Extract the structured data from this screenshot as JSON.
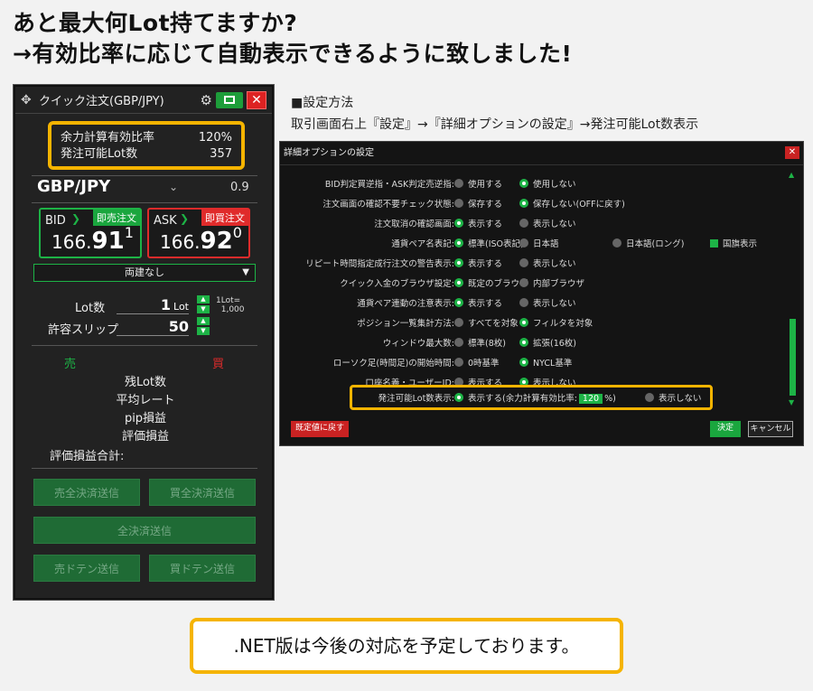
{
  "headline": {
    "line1": "あと最大何Lot持てますか?",
    "line2": "→有効比率に応じて自動表示できるように致しました!"
  },
  "quick_order": {
    "title": "クイック注文(GBP/JPY)",
    "margin_label": "余力計算有効比率",
    "margin_value": "120%",
    "orderable_label": "発注可能Lot数",
    "orderable_value": "357",
    "pair": "GBP/JPY",
    "spread": "0.9",
    "bid": {
      "label": "BID",
      "tag": "即売注文",
      "small": "166.",
      "big": "91",
      "sup": "1"
    },
    "ask": {
      "label": "ASK",
      "tag": "即買注文",
      "small": "166.",
      "big": "92",
      "sup": "0"
    },
    "hedge": "両建なし",
    "lot_label": "Lot数",
    "lot_value": "1",
    "lot_unit": "Lot",
    "lot_note_1": "1Lot=",
    "lot_note_2": "1,000",
    "slip_label": "許容スリップ",
    "slip_value": "50",
    "sell": "売",
    "buy": "買",
    "stats": [
      "残Lot数",
      "平均レート",
      "pip損益",
      "評価損益"
    ],
    "eval_total": "評価損益合計:",
    "buttons": {
      "sell_close": "売全決済送信",
      "buy_close": "買全決済送信",
      "all_close": "全決済送信",
      "sell_doten": "売ドテン送信",
      "buy_doten": "買ドテン送信"
    }
  },
  "settings": {
    "heading": "■設定方法",
    "path": "取引画面右上『設定』→『詳細オプションの設定』→発注可能Lot数表示"
  },
  "dialog": {
    "title": "詳細オプションの設定",
    "rows": [
      {
        "label": "BID判定買逆指・ASK判定売逆指:",
        "o1": "使用する",
        "o2": "使用しない",
        "sel": 2
      },
      {
        "label": "注文画面の確認不要チェック状態:",
        "o1": "保存する",
        "o2": "保存しない(OFFに戻す)",
        "sel": 2
      },
      {
        "label": "注文取消の確認画面:",
        "o1": "表示する",
        "o2": "表示しない",
        "sel": 1
      },
      {
        "label": "通貨ペア名表記:",
        "o1": "標準(ISO表記)",
        "o2": "日本語",
        "o3": "日本語(ロング)",
        "o4": "国旗表示",
        "sel": 1
      },
      {
        "label": "リピート時間指定成行注文の警告表示:",
        "o1": "表示する",
        "o2": "表示しない",
        "sel": 1
      },
      {
        "label": "クイック入金のブラウザ設定:",
        "o1": "既定のブラウザ",
        "o2": "内部ブラウザ",
        "sel": 1
      },
      {
        "label": "通貨ペア連動の注意表示:",
        "o1": "表示する",
        "o2": "表示しない",
        "sel": 1
      },
      {
        "label": "ポジション一覧集計方法:",
        "o1": "すべてを対象",
        "o2": "フィルタを対象",
        "sel": 2
      },
      {
        "label": "ウィンドウ最大数:",
        "o1": "標準(8枚)",
        "o2": "拡張(16枚)",
        "sel": 2
      },
      {
        "label": "ローソク足(時間足)の開始時間:",
        "o1": "0時基準",
        "o2": "NYCL基準",
        "sel": 2
      },
      {
        "label": "口座名義・ユーザーID:",
        "o1": "表示する",
        "o2": "表示しない",
        "sel": 2
      }
    ],
    "lot_row": {
      "label": "発注可能Lot数表示:",
      "o1": "表示する(余力計算有効比率:",
      "pct": "120",
      "pct_unit": "%)",
      "o2": "表示しない"
    },
    "btn_reset": "既定値に戻す",
    "btn_ok": "決定",
    "btn_cancel": "キャンセル"
  },
  "net_note": ".NET版は今後の対応を予定しております。"
}
